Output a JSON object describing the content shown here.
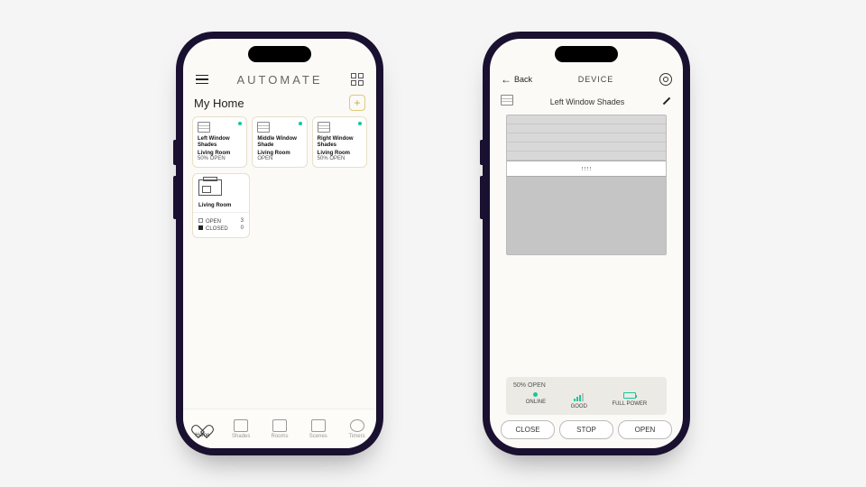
{
  "home": {
    "brand": "AUTOMATE",
    "section_title": "My Home",
    "shades": [
      {
        "name": "Left Window Shades",
        "room": "Living Room",
        "status": "50% OPEN"
      },
      {
        "name": "Middle Window Shade",
        "room": "Living Room",
        "status": "OPEN"
      },
      {
        "name": "Right Window Shades",
        "room": "Living Room",
        "status": "50% OPEN"
      }
    ],
    "room": {
      "name": "Living Room",
      "open_label": "OPEN",
      "open_count": "3",
      "closed_label": "CLOSED",
      "closed_count": "0"
    },
    "tabs": {
      "home": "Home",
      "shades": "Shades",
      "rooms": "Rooms",
      "scenes": "Scenes",
      "timers": "Timers"
    }
  },
  "device": {
    "back_label": "Back",
    "header_title": "DEVICE",
    "name": "Left Window Shades",
    "open_status": "50% OPEN",
    "status": {
      "online": "ONLINE",
      "signal": "GOOD",
      "power": "FULL POWER"
    },
    "controls": {
      "close": "CLOSE",
      "stop": "STOP",
      "open": "OPEN"
    }
  },
  "colors": {
    "accent": "#16c79a",
    "gold": "#c8a84a"
  }
}
